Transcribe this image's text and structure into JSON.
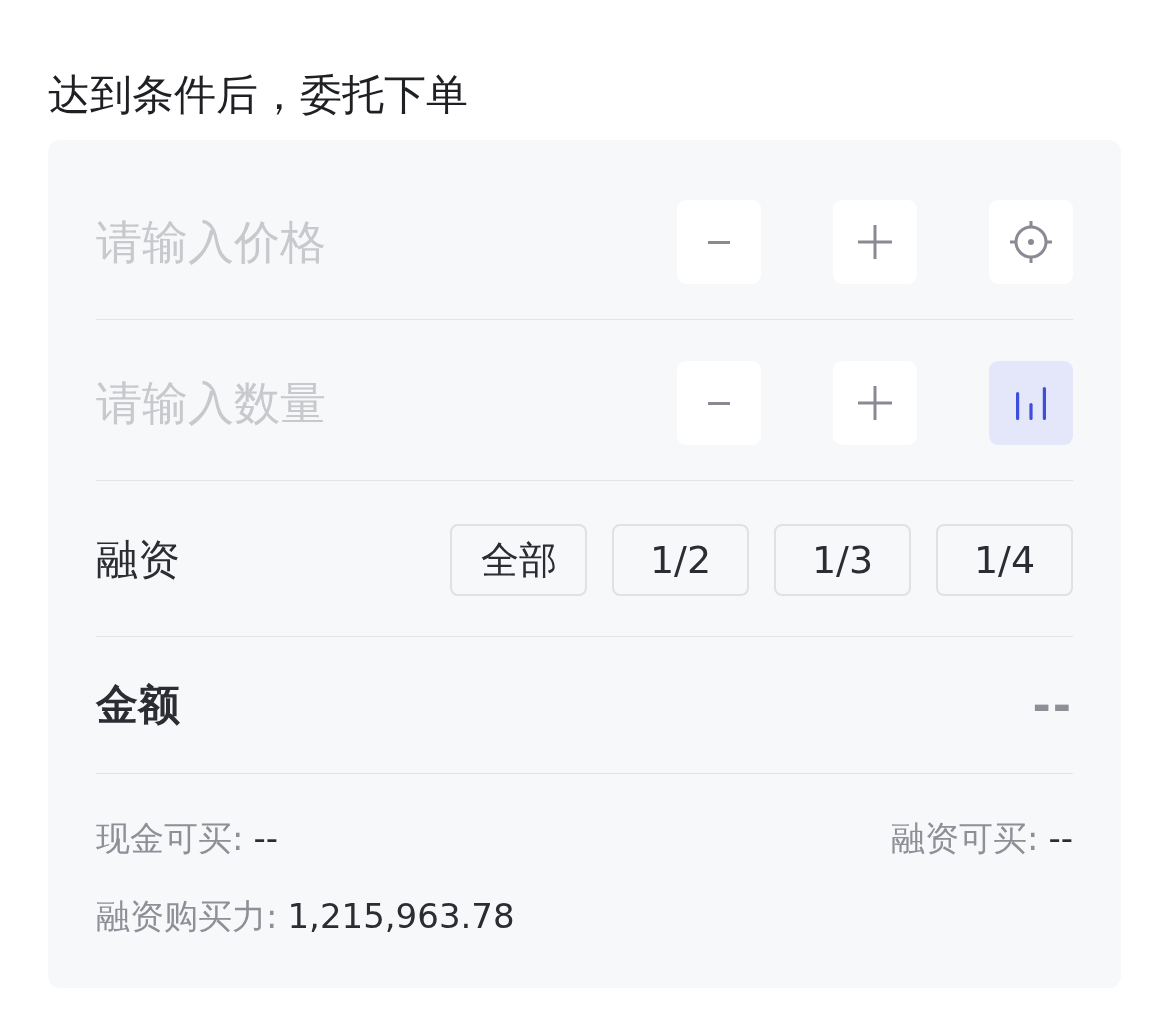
{
  "header": {
    "title": "达到条件后，委托下单"
  },
  "inputs": [
    {
      "kind": "price",
      "placeholder": "请输入价格",
      "tool_on": false
    },
    {
      "kind": "quantity",
      "placeholder": "请输入数量",
      "tool_on": true
    }
  ],
  "financing": {
    "label": "融资",
    "ratios": [
      {
        "label": "全部",
        "selected": false
      },
      {
        "label": "1/2",
        "selected": false
      },
      {
        "label": "1/3",
        "selected": false
      },
      {
        "label": "1/4",
        "selected": false
      }
    ]
  },
  "amount": {
    "label": "金额",
    "value": "--"
  },
  "availability": {
    "cash": {
      "label": "现金可买:",
      "value": "--"
    },
    "margin": {
      "label": "融资可买:",
      "value": "--"
    },
    "buying_power": {
      "label": "融资购买力:",
      "value": "1,215,963.78"
    }
  }
}
